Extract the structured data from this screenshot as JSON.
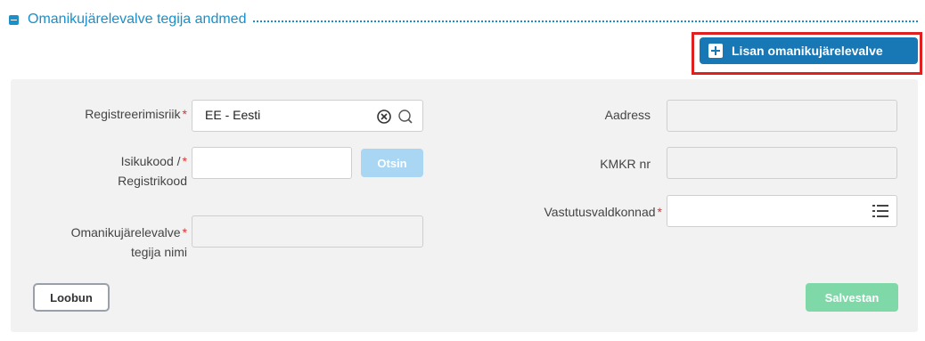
{
  "section": {
    "title": "Omanikujärelevalve tegija andmed"
  },
  "actions": {
    "add_label": "Lisan omanikujärelevalve"
  },
  "form": {
    "country": {
      "label": "Registreerimisriik",
      "value": "EE - Eesti"
    },
    "id_code": {
      "label_line1": "Isikukood /",
      "label_line2": "Registrikood",
      "value": ""
    },
    "search_label": "Otsin",
    "name": {
      "label_line1": "Omanikujärelevalve",
      "label_line2": "tegija nimi",
      "value": ""
    },
    "address": {
      "label": "Aadress",
      "value": ""
    },
    "vat": {
      "label": "KMKR nr",
      "value": ""
    },
    "responsibility": {
      "label": "Vastutusvaldkonnad",
      "value": ""
    },
    "required_mark": "*"
  },
  "footer": {
    "cancel_label": "Loobun",
    "save_label": "Salvestan"
  },
  "icons": {
    "clear": "clear-icon",
    "search": "search-icon",
    "list": "list-icon",
    "collapse": "collapse-icon",
    "add": "plus-icon"
  },
  "colors": {
    "accent": "#1a8fc9",
    "primary_button": "#1877b5",
    "highlight": "#e02020",
    "save_button": "#7fd8a8",
    "search_button": "#a9d6f2",
    "required": "#e03030"
  }
}
